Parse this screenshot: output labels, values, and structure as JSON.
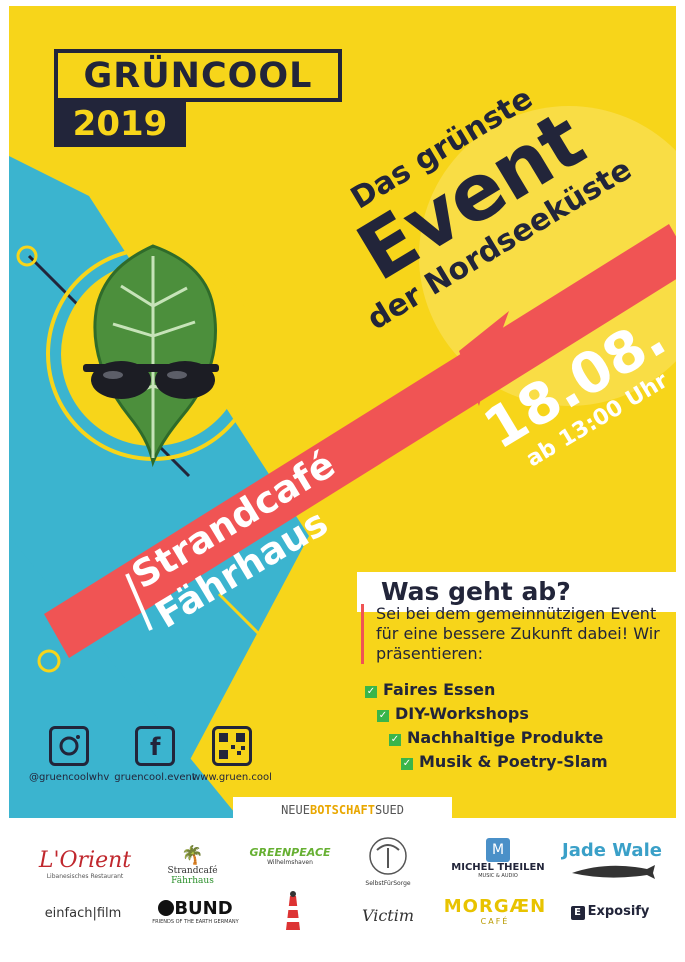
{
  "logo": {
    "name": "GRÜNCOOL",
    "year": "2019"
  },
  "tagline": {
    "line1": "Das grünste",
    "line2": "Event",
    "line3": "der Nordseeküste"
  },
  "date": {
    "day": "18.08.",
    "time": "ab 13:00 Uhr"
  },
  "venue": {
    "line1": "Strandcafé",
    "line2": "Fährhaus"
  },
  "info": {
    "heading": "Was geht ab?",
    "intro": "Sei bei dem gemeinnützigen Event für eine bessere Zukunft dabei! Wir präsentieren:",
    "items": [
      "Faires Essen",
      "DIY-Workshops",
      "Nachhaltige Produkte",
      "Musik & Poetry-Slam"
    ]
  },
  "social": [
    {
      "icon": "instagram-icon",
      "label": "@gruencoolwhv"
    },
    {
      "icon": "facebook-icon",
      "label": "gruencool.event"
    },
    {
      "icon": "qr-code-icon",
      "label": "www.gruen.cool"
    }
  ],
  "banner": {
    "part1": "NEUE",
    "part2": "BOTSCHAFT",
    "part3": "SUED"
  },
  "sponsors": {
    "lorient": {
      "name": "L'Orient",
      "sub": "Libanesisches Restaurant"
    },
    "strandcafe": {
      "a": "Strandcafé",
      "b": "Fährhaus"
    },
    "greenpeace": {
      "name": "GREENPEACE",
      "sub": "Wilhelmshaven"
    },
    "selbstfuersorge": {
      "name": "SelbstFürSorge"
    },
    "michel": {
      "name": "MICHEL THEILEN",
      "sub": "MUSIC & AUDIO"
    },
    "jadewale": {
      "name": "Jade Wale"
    },
    "einfachfilm": {
      "name": "einfach|film"
    },
    "bund": {
      "name": "BUND",
      "sub": "FRIENDS OF THE EARTH GERMANY"
    },
    "victim": {
      "name": "Victim"
    },
    "morgaen": {
      "name": "MORGÆN",
      "sub": "CAFÉ"
    },
    "exposify": {
      "name": "Exposify"
    }
  },
  "colors": {
    "yellow": "#f7d51a",
    "blue": "#3bb4cf",
    "navy": "#22253a",
    "red": "#f05454",
    "green": "#39b54a"
  }
}
